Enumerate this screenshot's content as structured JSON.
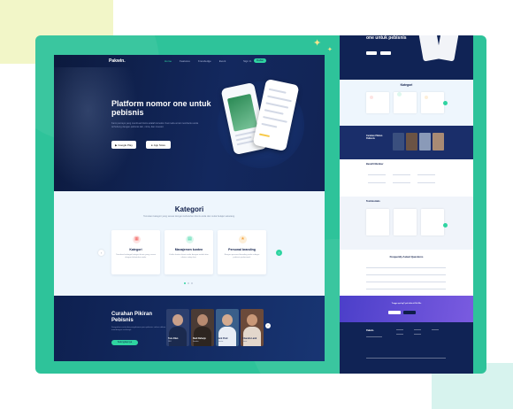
{
  "nav": {
    "logo": "Pakwin.",
    "links": [
      "Home",
      "Features",
      "Knowledge",
      "Event"
    ],
    "signin": "Sign In",
    "cta": "Daftar"
  },
  "hero": {
    "title": "Platform nomor one untuk pebisnis",
    "description": "Kami percaya yang membuat bisnis adalah koneksi. Kami ada untuk membantu anda terhubung dengan pebisnis lain, mitra, dan investor.",
    "google_play": "Google Play",
    "app_store": "App Store"
  },
  "kategori": {
    "title": "Kategori",
    "subtitle": "Temukan kategori yang sesuai dengan kebutuhan bisnis anda dan mulai belajar sekarang.",
    "cards": [
      {
        "icon": "grid-icon",
        "title": "Kategori",
        "desc": "Temukan berbagai kategori bisnis yang sesuai dengan kebutuhan anda.",
        "color": "#f25f5c"
      },
      {
        "icon": "document-icon",
        "title": "Manajemen konten",
        "desc": "Kelola konten bisnis anda dengan mudah dan efisien setiap hari.",
        "color": "#2fd4a1"
      },
      {
        "icon": "star-icon",
        "title": "Personal branding",
        "desc": "Bangun personal branding anda sebagai pebisnis profesional.",
        "color": "#f7a440"
      }
    ],
    "prev": "‹",
    "next": "›"
  },
  "curahan": {
    "title": "Curahan Pikiran Pebisnis",
    "description": "Dengarkan cerita dan pengalaman para pebisnis sukses dalam membangun usahanya.",
    "cta": "Selengkapnya",
    "people": [
      {
        "name": "Tom Allan",
        "role": "CEO",
        "color": "#2c3f6e"
      },
      {
        "name": "Budi Raharjo",
        "role": "Founder",
        "color": "#4a3b35"
      },
      {
        "name": "Jack Pratt",
        "role": "Director",
        "color": "#3a5f8a"
      },
      {
        "name": "Chandra Laird",
        "role": "Owner",
        "color": "#6b4a3a"
      }
    ],
    "next": "›"
  },
  "right_page": {
    "hero_title": "one untuk pebisnis",
    "kategori_title": "Kategori",
    "curahan_title": "Curahan Pikiran Pebisnis",
    "benefit_title": "Benefit Member",
    "testimonials_title": "Testimonials",
    "faq_title": "Frequently Asked Questions",
    "cta_title": "Tunggu apa lagi? yuk daftar di Pak Win",
    "footer_logo": "Pakwin."
  },
  "colors": {
    "frame": "#2ec39a",
    "navy": "#0f1e4a",
    "accent": "#2fd4a1"
  }
}
